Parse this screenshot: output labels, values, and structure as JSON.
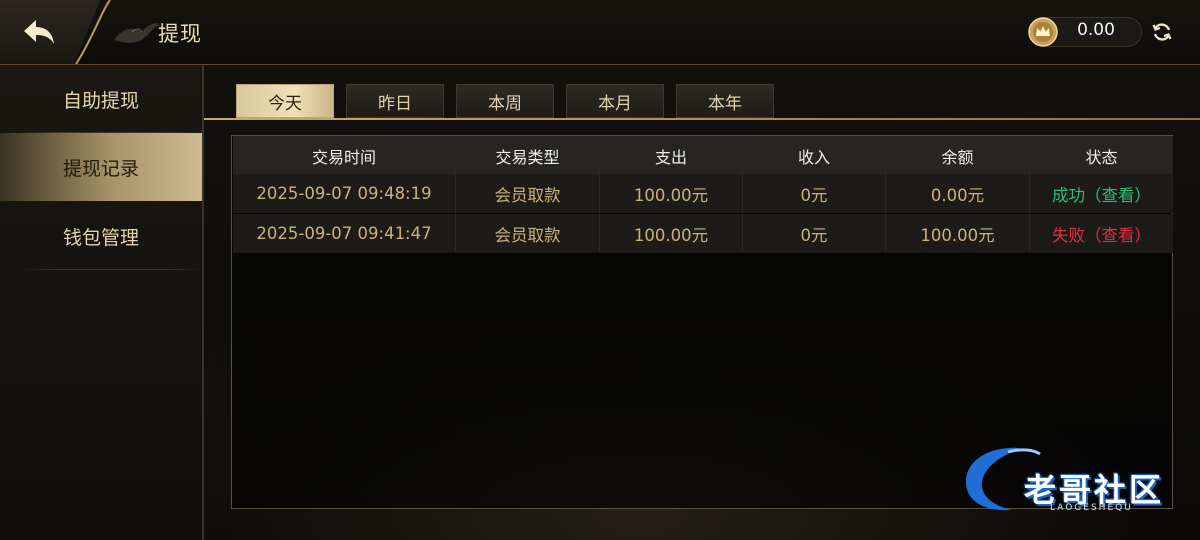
{
  "header": {
    "title": "提现",
    "balance": "0.00",
    "back_icon": "back-arrow-icon",
    "coin_icon": "crown-coin-icon",
    "refresh_icon": "refresh-icon"
  },
  "sidebar": {
    "items": [
      {
        "label": "自助提现",
        "active": false
      },
      {
        "label": "提现记录",
        "active": true
      },
      {
        "label": "钱包管理",
        "active": false
      }
    ]
  },
  "tabs": [
    {
      "label": "今天",
      "active": true
    },
    {
      "label": "昨日",
      "active": false
    },
    {
      "label": "本周",
      "active": false
    },
    {
      "label": "本月",
      "active": false
    },
    {
      "label": "本年",
      "active": false
    }
  ],
  "table": {
    "headers": [
      "交易时间",
      "交易类型",
      "支出",
      "收入",
      "余额",
      "状态"
    ],
    "rows": [
      {
        "time": "2025-09-07 09:48:19",
        "type": "会员取款",
        "out": "100.00元",
        "in": "0元",
        "balance": "0.00元",
        "status": "成功（查看）",
        "status_kind": "success"
      },
      {
        "time": "2025-09-07 09:41:47",
        "type": "会员取款",
        "out": "100.00元",
        "in": "0元",
        "balance": "100.00元",
        "status": "失败（查看）",
        "status_kind": "fail"
      }
    ]
  },
  "colors": {
    "gold": "#c7ab6a",
    "success": "#2fbd7a",
    "fail": "#e02e45"
  },
  "watermark": {
    "text": "老哥社区",
    "sub": "LAOGESHEQU"
  }
}
